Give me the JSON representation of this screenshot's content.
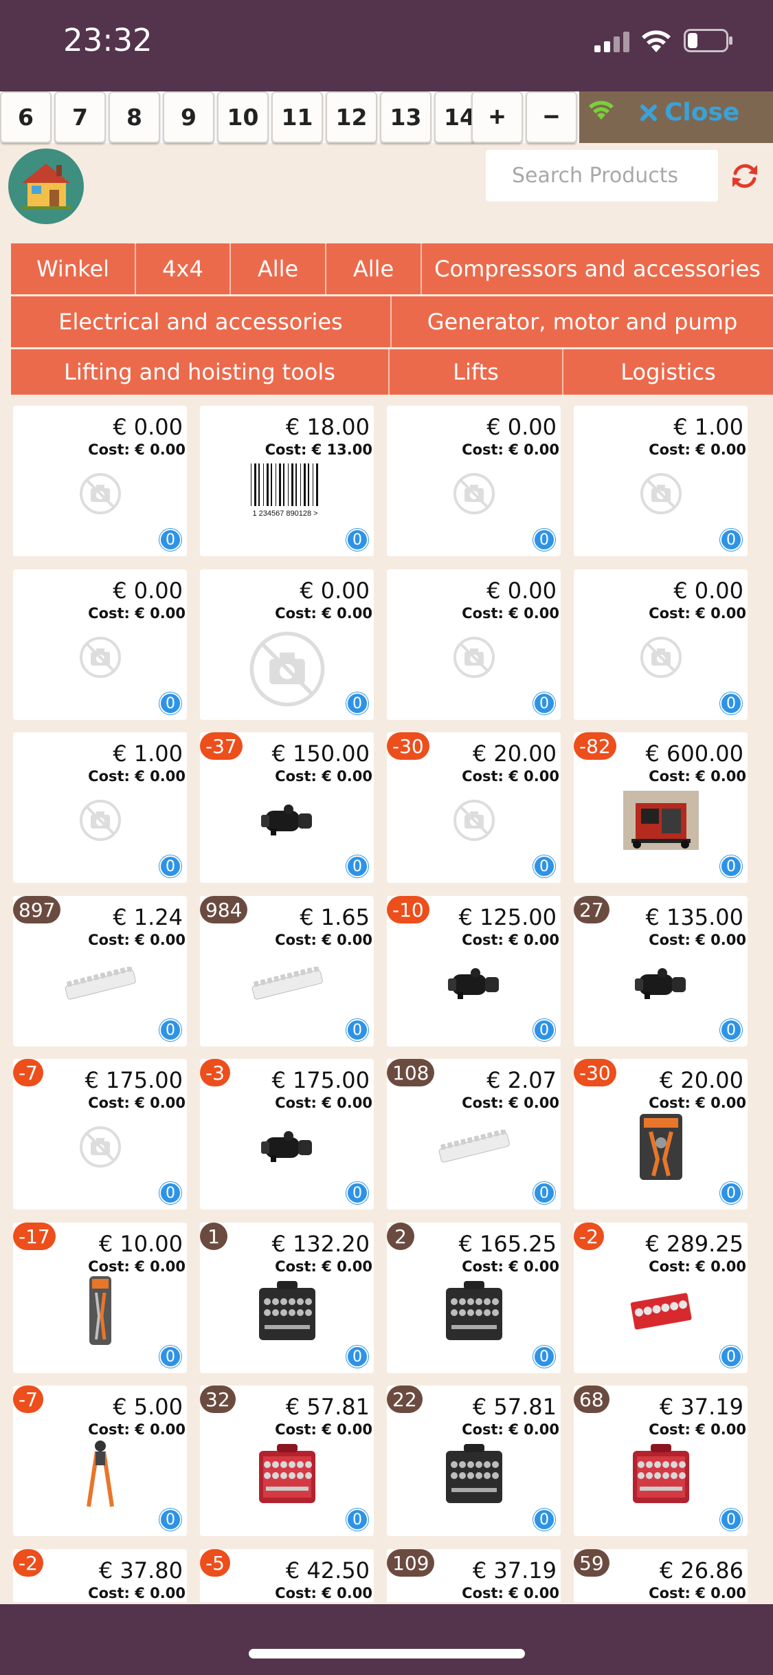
{
  "status": {
    "time": "23:32"
  },
  "tables": [
    "6",
    "7",
    "8",
    "9",
    "10",
    "11",
    "12",
    "13",
    "14"
  ],
  "controls": {
    "plus": "+",
    "minus": "−",
    "close": "Close"
  },
  "search": {
    "placeholder": "Search Products"
  },
  "categories": [
    "Winkel",
    "4x4",
    "Alle",
    "Alle",
    "Compressors and accessories",
    "Electrical and accessories",
    "Generator, motor and pump",
    "Lifting and hoisting tools",
    "Lifts",
    "Logistics"
  ],
  "products": [
    {
      "price": "€ 0.00",
      "cost": "Cost: € 0.00",
      "stock": "",
      "stock_type": "",
      "image": "no-photo-icon",
      "qty": "0"
    },
    {
      "price": "€ 18.00",
      "cost": "Cost: € 13.00",
      "stock": "",
      "stock_type": "",
      "image": "barcode-image",
      "barcode_text": "1 234567 890128 >",
      "qty": "0"
    },
    {
      "price": "€ 0.00",
      "cost": "Cost: € 0.00",
      "stock": "",
      "stock_type": "",
      "image": "no-photo-icon",
      "qty": "0"
    },
    {
      "price": "€ 1.00",
      "cost": "Cost: € 0.00",
      "stock": "",
      "stock_type": "",
      "image": "no-photo-icon",
      "qty": "0"
    },
    {
      "price": "€ 0.00",
      "cost": "Cost: € 0.00",
      "stock": "",
      "stock_type": "",
      "image": "no-photo-icon",
      "qty": "0"
    },
    {
      "price": "€ 0.00",
      "cost": "Cost: € 0.00",
      "stock": "",
      "stock_type": "",
      "image": "no-photo-large-icon",
      "qty": "0"
    },
    {
      "price": "€ 0.00",
      "cost": "Cost: € 0.00",
      "stock": "",
      "stock_type": "",
      "image": "no-photo-icon",
      "qty": "0"
    },
    {
      "price": "€ 0.00",
      "cost": "Cost: € 0.00",
      "stock": "",
      "stock_type": "",
      "image": "no-photo-icon",
      "qty": "0"
    },
    {
      "price": "€ 1.00",
      "cost": "Cost: € 0.00",
      "stock": "",
      "stock_type": "",
      "image": "no-photo-icon",
      "qty": "0"
    },
    {
      "price": "€ 150.00",
      "cost": "Cost: € 0.00",
      "stock": "-37",
      "stock_type": "neg",
      "image": "starter-motor-image",
      "qty": "0"
    },
    {
      "price": "€ 20.00",
      "cost": "Cost: € 0.00",
      "stock": "-30",
      "stock_type": "neg",
      "image": "no-photo-icon",
      "qty": "0"
    },
    {
      "price": "€ 600.00",
      "cost": "Cost: € 0.00",
      "stock": "-82",
      "stock_type": "neg",
      "image": "generator-image",
      "qty": "0"
    },
    {
      "price": "€ 1.24",
      "cost": "Cost: € 0.00",
      "stock": "897",
      "stock_type": "pos",
      "image": "terminal-strip-image",
      "qty": "0"
    },
    {
      "price": "€ 1.65",
      "cost": "Cost: € 0.00",
      "stock": "984",
      "stock_type": "pos",
      "image": "terminal-strip-image",
      "qty": "0"
    },
    {
      "price": "€ 125.00",
      "cost": "Cost: € 0.00",
      "stock": "-10",
      "stock_type": "neg",
      "image": "starter-motor-image",
      "qty": "0"
    },
    {
      "price": "€ 135.00",
      "cost": "Cost: € 0.00",
      "stock": "27",
      "stock_type": "pos",
      "image": "starter-motor-image",
      "qty": "0"
    },
    {
      "price": "€ 175.00",
      "cost": "Cost: € 0.00",
      "stock": "-7",
      "stock_type": "neg",
      "image": "no-photo-icon",
      "qty": "0"
    },
    {
      "price": "€ 175.00",
      "cost": "Cost: € 0.00",
      "stock": "-3",
      "stock_type": "neg",
      "image": "starter-motor-image",
      "qty": "0"
    },
    {
      "price": "€ 2.07",
      "cost": "Cost: € 0.00",
      "stock": "108",
      "stock_type": "pos",
      "image": "terminal-strip-image",
      "qty": "0"
    },
    {
      "price": "€ 20.00",
      "cost": "Cost: € 0.00",
      "stock": "-30",
      "stock_type": "neg",
      "image": "pliers-set-image",
      "qty": "0"
    },
    {
      "price": "€ 10.00",
      "cost": "Cost: € 0.00",
      "stock": "-17",
      "stock_type": "neg",
      "image": "pliers-card-image",
      "qty": "0"
    },
    {
      "price": "€ 132.20",
      "cost": "Cost: € 0.00",
      "stock": "1",
      "stock_type": "pos",
      "image": "socket-case-dark-image",
      "qty": "0"
    },
    {
      "price": "€ 165.25",
      "cost": "Cost: € 0.00",
      "stock": "2",
      "stock_type": "pos",
      "image": "socket-case-dark-image",
      "qty": "0"
    },
    {
      "price": "€ 289.25",
      "cost": "Cost: € 0.00",
      "stock": "-2",
      "stock_type": "neg",
      "image": "socket-box-red-image",
      "qty": "0"
    },
    {
      "price": "€ 5.00",
      "cost": "Cost: € 0.00",
      "stock": "-7",
      "stock_type": "neg",
      "image": "wire-stripper-image",
      "qty": "0"
    },
    {
      "price": "€ 57.81",
      "cost": "Cost: € 0.00",
      "stock": "32",
      "stock_type": "pos",
      "image": "socket-case-red-image",
      "qty": "0"
    },
    {
      "price": "€ 57.81",
      "cost": "Cost: € 0.00",
      "stock": "22",
      "stock_type": "pos",
      "image": "socket-case-dark-image",
      "qty": "0"
    },
    {
      "price": "€ 37.19",
      "cost": "Cost: € 0.00",
      "stock": "68",
      "stock_type": "pos",
      "image": "socket-case-red-image",
      "qty": "0"
    },
    {
      "price": "€ 37.80",
      "cost": "Cost: € 0.00",
      "stock": "-2",
      "stock_type": "neg",
      "image": "",
      "qty": ""
    },
    {
      "price": "€ 42.50",
      "cost": "Cost: € 0.00",
      "stock": "-5",
      "stock_type": "neg",
      "image": "",
      "qty": ""
    },
    {
      "price": "€ 37.19",
      "cost": "Cost: € 0.00",
      "stock": "109",
      "stock_type": "pos",
      "image": "",
      "qty": ""
    },
    {
      "price": "€ 26.86",
      "cost": "Cost: € 0.00",
      "stock": "59",
      "stock_type": "pos",
      "image": "",
      "qty": ""
    }
  ]
}
